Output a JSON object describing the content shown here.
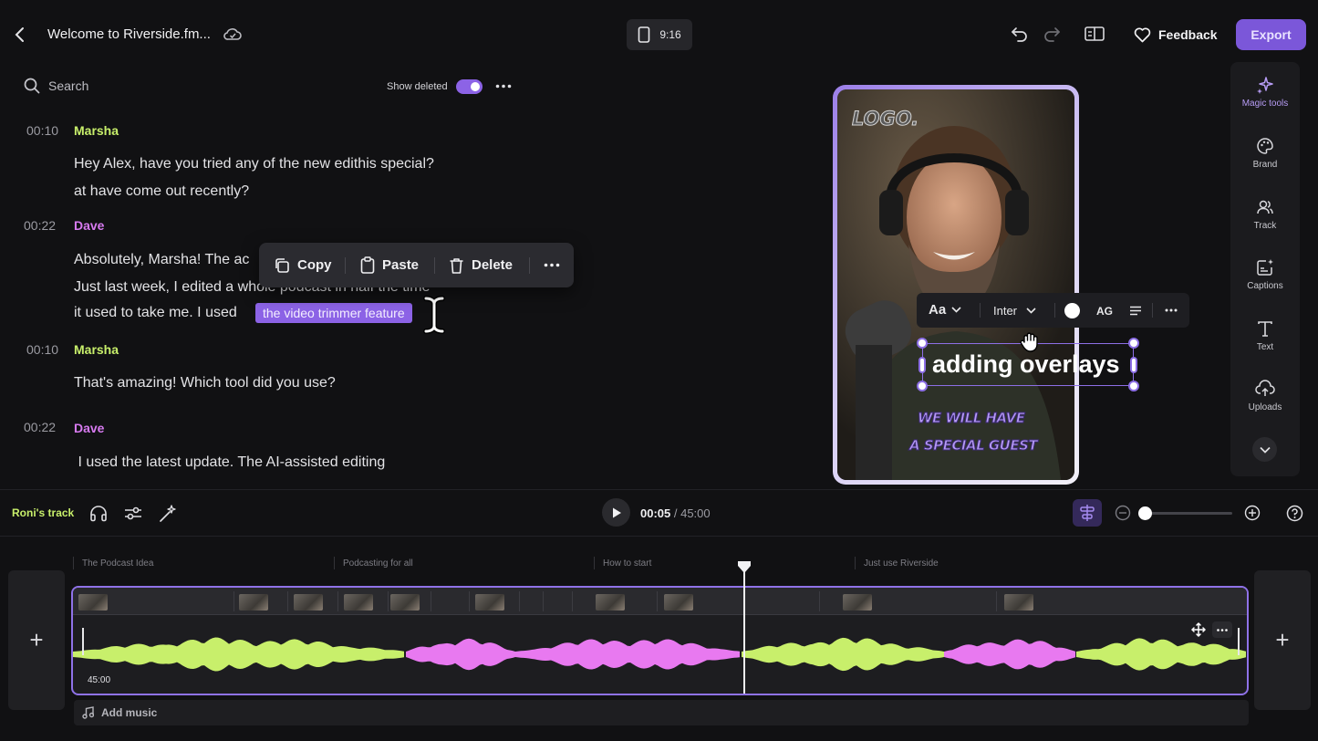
{
  "header": {
    "title": "Welcome to Riverside.fm...",
    "aspect_ratio": "9:16",
    "feedback_label": "Feedback",
    "export_label": "Export"
  },
  "transcript": {
    "search_placeholder": "Search",
    "show_deleted_label": "Show deleted",
    "show_deleted_on": true,
    "blocks": [
      {
        "time": "00:10",
        "speaker": "Marsha",
        "color": "#c8ef6b",
        "lines": [
          "Hey Alex, have you tried any of the new edithis special?",
          "at have come out recently?"
        ]
      },
      {
        "time": "00:22",
        "speaker": "Dave",
        "color": "#d77af0",
        "lines": [
          "Absolutely, Marsha! The ac",
          "Just last week, I edited a whole podcast in half the time",
          "it used to take me. I used"
        ],
        "highlight": "the video trimmer feature"
      },
      {
        "time": "00:10",
        "speaker": "Marsha",
        "color": "#c8ef6b",
        "lines": [
          "That's amazing! Which tool did you use?"
        ]
      },
      {
        "time": "00:22",
        "speaker": "Dave",
        "color": "#d77af0",
        "lines": [
          " I used the latest update. The AI-assisted editing"
        ]
      }
    ]
  },
  "context_menu": {
    "copy": "Copy",
    "paste": "Paste",
    "delete": "Delete"
  },
  "preview": {
    "logo": "LOGO.",
    "overlay_text": "adding overlays",
    "promo_line1": "WE WILL HAVE",
    "promo_line2": "A SPECIAL GUEST",
    "toolbar": {
      "size_label": "Aa",
      "font": "Inter",
      "case_label": "AG"
    }
  },
  "tools": [
    {
      "label": "Magic tools",
      "icon": "sparkle-icon",
      "active": true
    },
    {
      "label": "Brand",
      "icon": "palette-icon"
    },
    {
      "label": "Track",
      "icon": "people-icon"
    },
    {
      "label": "Captions",
      "icon": "captions-icon"
    },
    {
      "label": "Text",
      "icon": "text-icon"
    },
    {
      "label": "Uploads",
      "icon": "upload-icon"
    }
  ],
  "timeline": {
    "track_name": "Roni's track",
    "current_time": "00:05",
    "separator": " / ",
    "total_time": "45:00",
    "sections": [
      "The Podcast Idea",
      "Podcasting for all",
      "How to start",
      "Just use Riverside"
    ],
    "clip_duration": "45:00",
    "add_music": "Add music",
    "accent_green": "#c8ef6b",
    "accent_pink": "#e879f0"
  }
}
